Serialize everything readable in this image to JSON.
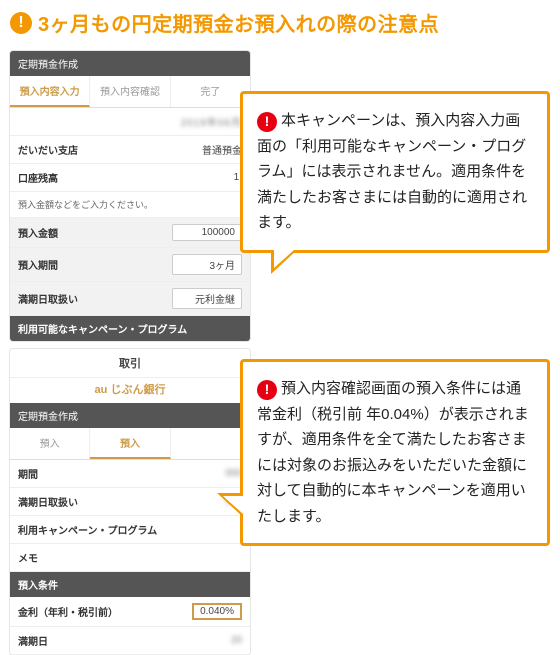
{
  "heading": {
    "icon_glyph": "!",
    "text": "3ヶ月もの円定期預金お預入れの際の注意点"
  },
  "block1": {
    "shot": {
      "header": "定期預金作成",
      "tabs": [
        "預入内容入力",
        "預入内容確認",
        "完了"
      ],
      "active_tab": 0,
      "date_blur": "2019年06月",
      "rows": [
        {
          "label": "だいだい支店",
          "value": "普通預金"
        },
        {
          "label": "口座残高",
          "value": "1,"
        }
      ],
      "note": "預入金額などをご入力ください。",
      "inputs": [
        {
          "label": "預入金額",
          "value": "100000"
        },
        {
          "label": "預入期間",
          "value": "3ヶ月"
        },
        {
          "label": "満期日取扱い",
          "value": "元利金継"
        }
      ],
      "band": "利用可能なキャンペーン・プログラム"
    },
    "callout": {
      "icon_glyph": "!",
      "text": "本キャンペーンは、預入内容入力画面の「利用可能なキャンペーン・プログラム」には表示されません。適用条件を満たしたお客さまには自動的に適用されます。"
    }
  },
  "block2": {
    "shot": {
      "title_bar": "取引",
      "logo": "au じぶん銀行",
      "header": "定期預金作成",
      "tabs": [
        "預入",
        "預入"
      ],
      "rows": [
        {
          "label": "期間",
          "value": ""
        },
        {
          "label": "満期日取扱い",
          "value": ""
        },
        {
          "label": "利用キャンペーン・プログラム",
          "value": ""
        },
        {
          "label": "メモ",
          "value": ""
        }
      ],
      "band": "預入条件",
      "rate_row": {
        "label": "金利（年利・税引前）",
        "value": "0.040%"
      },
      "last_row": {
        "label": "満期日",
        "value": "20"
      }
    },
    "callout": {
      "icon_glyph": "!",
      "text": "預入内容確認画面の預入条件には通常金利（税引前 年0.04%）が表示されますが、適用条件を全て満たしたお客さまには対象のお振込みをいただいた金額に対して自動的に本キャンペーンを適用いたします。"
    }
  }
}
